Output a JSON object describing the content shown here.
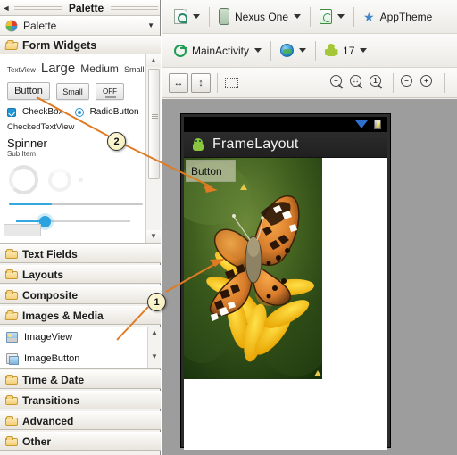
{
  "window": {
    "panel_title": "Palette",
    "collapse_icon": "collapse-left-arrow"
  },
  "palette": {
    "header_label": "Palette",
    "header_icon": "palette-icon",
    "groups": [
      {
        "label": "Form Widgets",
        "expanded": true,
        "icon": "folder-open-icon"
      },
      {
        "label": "Text Fields",
        "expanded": false,
        "icon": "folder-icon"
      },
      {
        "label": "Layouts",
        "expanded": false,
        "icon": "folder-icon"
      },
      {
        "label": "Composite",
        "expanded": false,
        "icon": "folder-icon"
      },
      {
        "label": "Images & Media",
        "expanded": true,
        "icon": "folder-open-icon"
      },
      {
        "label": "Time & Date",
        "expanded": false,
        "icon": "folder-icon"
      },
      {
        "label": "Transitions",
        "expanded": false,
        "icon": "folder-icon"
      },
      {
        "label": "Advanced",
        "expanded": false,
        "icon": "folder-icon"
      },
      {
        "label": "Other",
        "expanded": false,
        "icon": "folder-icon"
      }
    ],
    "form_widgets": {
      "textview_label": "TextView",
      "large_label": "Large",
      "medium_label": "Medium",
      "small_label": "Small",
      "button_label": "Button",
      "small_button_label": "Small",
      "toggle_label": "OFF",
      "checkbox_label": "CheckBox",
      "radiobutton_label": "RadioButton",
      "checkedtextview_label": "CheckedTextView",
      "spinner_label": "Spinner",
      "spinner_subitem_label": "Sub Item"
    },
    "images_media": {
      "items": [
        {
          "label": "ImageView",
          "icon": "image-view-icon"
        },
        {
          "label": "ImageButton",
          "icon": "image-button-icon"
        }
      ]
    }
  },
  "toolbar_top": {
    "config_icon": "layout-config-icon",
    "device_icon": "device-icon",
    "device_label": "Nexus One",
    "orientation_icon": "orientation-icon",
    "theme_icon": "star-icon",
    "theme_label": "AppTheme"
  },
  "toolbar_mid": {
    "activity_icon": "activity-icon",
    "activity_label": "MainActivity",
    "locale_icon": "globe-icon",
    "api_icon": "android-icon",
    "api_label": "17"
  },
  "toolbar_bottom": {
    "fit_width_icon": "fit-horizontal-icon",
    "fit_height_icon": "fit-vertical-icon",
    "outline_icon": "show-outlines-icon",
    "zoom_out_fit_icon": "zoom-out-icon",
    "zoom_fit_icon": "zoom-fit-icon",
    "zoom_actual_icon": "zoom-100-icon",
    "zoom_minus_icon": "zoom-minus-icon",
    "zoom_plus_icon": "zoom-plus-icon"
  },
  "preview": {
    "status_wifi_icon": "wifi-icon",
    "status_battery_icon": "battery-icon",
    "app_icon": "android-robot-icon",
    "title": "FrameLayout",
    "button_label": "Button",
    "warning_icon": "warning-triangle-icon"
  },
  "callouts": [
    {
      "number": "2"
    },
    {
      "number": "1"
    }
  ]
}
